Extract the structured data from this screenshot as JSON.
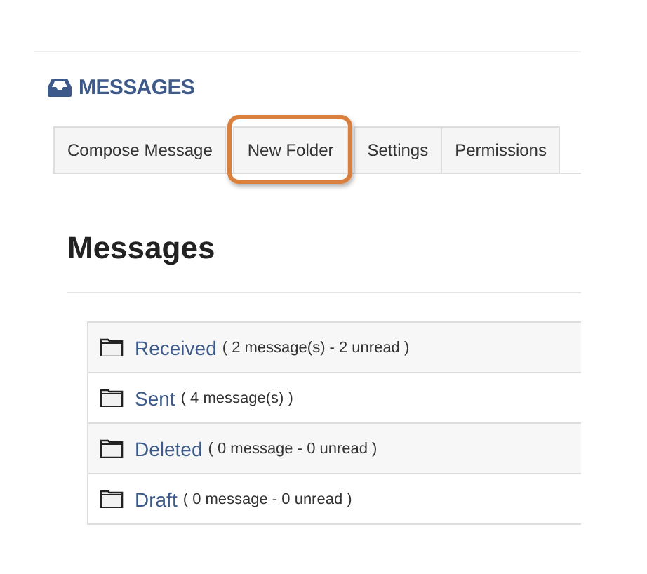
{
  "header": {
    "title": "MESSAGES"
  },
  "tabs": [
    {
      "label": "Compose Message",
      "highlighted": false
    },
    {
      "label": "New Folder",
      "highlighted": true
    },
    {
      "label": "Settings",
      "highlighted": false
    },
    {
      "label": "Permissions",
      "highlighted": false
    }
  ],
  "heading": "Messages",
  "folders": [
    {
      "name": "Received",
      "detail": "( 2 message(s) - 2 unread )"
    },
    {
      "name": "Sent",
      "detail": "( 4 message(s) )"
    },
    {
      "name": "Deleted",
      "detail": "( 0 message - 0 unread )"
    },
    {
      "name": "Draft",
      "detail": "( 0 message - 0 unread )"
    }
  ]
}
